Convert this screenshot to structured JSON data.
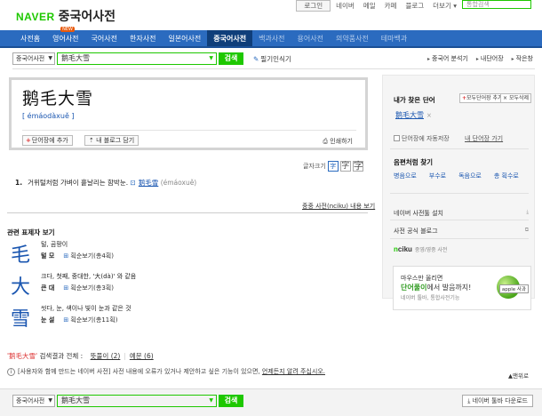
{
  "header": {
    "logo_brand": "NAVER",
    "logo_service": "중국어사전",
    "links": [
      "로그인",
      "네이버",
      "메일",
      "카페",
      "블로그",
      "더보기 ▾"
    ],
    "search_placeholder": "통합검색"
  },
  "nav": {
    "items": [
      {
        "label": "사전홈"
      },
      {
        "label": "영어사전",
        "badge": "NEW"
      },
      {
        "label": "국어사전"
      },
      {
        "label": "한자사전"
      },
      {
        "label": "일본어사전"
      },
      {
        "label": "중국어사전",
        "active": true
      },
      {
        "label": "백과사전"
      },
      {
        "label": "용어사전"
      },
      {
        "label": "의약품사전"
      },
      {
        "label": "테마백과"
      }
    ]
  },
  "search": {
    "scope": "중국어사전",
    "query": "鹅毛大雪",
    "button": "검색",
    "handwriting": "필기인식기",
    "right_links": [
      "중국어 분석기",
      "내단어장",
      "작은창"
    ]
  },
  "entry": {
    "headword": "鹅毛大雪",
    "pinyin": "[ émáodàxuě ]",
    "add_button": "단어장에 추가",
    "blog_button": "내 블로그 담기",
    "print": "인쇄하기"
  },
  "font_size": {
    "label": "글자크기",
    "options": [
      "字",
      "字",
      "字"
    ]
  },
  "meaning": {
    "num": "1.",
    "text": "거위털처럼 가벼이 흩날리는 함박눈.",
    "link": "鹅毛雪",
    "pinyin": "(émáoxuě)"
  },
  "more_link": "중중 사전(nciku) 내용 보기",
  "related": {
    "heading": "관련 표제자 보기",
    "chars": [
      {
        "char": "毛",
        "def": "털, 곰팡이",
        "reading": "털 모",
        "strokes": "획순보기(총4획)"
      },
      {
        "char": "大",
        "def": "크다, 첫째, 중대한, '大(dà)' 와 같음",
        "reading": "큰 대",
        "strokes": "획순보기(총3획)"
      },
      {
        "char": "雪",
        "def": "씻다, 눈, 색이나 빛이 눈과 같은 것",
        "reading": "눈 설",
        "strokes": "획순보기(총11획)"
      }
    ]
  },
  "results": {
    "keyword": "'鹅毛大雪'",
    "label": "검색결과 전체 :",
    "tab1": "뜻풀이 (2)",
    "tab2": "예문 (6)"
  },
  "notice": {
    "text": "[사용자와 함께 만드는 네이버 사전] 사전 내용에 오류가 있거나 제안하고 싶은 기능이 있으면,",
    "link": "언제든지 알려 주십시오."
  },
  "to_top": "▲맨위로",
  "bottom": {
    "scope": "중국어사전",
    "query": "鹅毛大雪",
    "button": "검색",
    "toolbar": "네이버 툴바 다운로드"
  },
  "sidebar": {
    "recent_heading": "내가 찾은 단어",
    "add_all": "모두단어장 추가",
    "delete_all": "모두삭제",
    "recent_word": "鹅毛大雪",
    "autosave": "단어장에 자동저장",
    "go_wordbook": "내 단어장 가기",
    "phonetic_heading": "음편처럼 찾기",
    "phonetic_items": [
      "병음으로",
      "부수로",
      "독음으로",
      "총 획수로"
    ],
    "links": [
      {
        "label": "네이버 사전툴 설치",
        "mark": "⤓"
      },
      {
        "label": "사전 공식 블로그",
        "mark": "⧉"
      }
    ],
    "nciku_prefix": "n",
    "nciku_name": "ciku",
    "nciku_sub": "중영/영중 사전",
    "ad": {
      "line1": "마우스만 올리면",
      "line2_green": "단어풀이",
      "line2_rest": "에서 발음까지!",
      "line3": "네이버 툴바, 통합사전기능",
      "tag": "apple 사과"
    }
  }
}
